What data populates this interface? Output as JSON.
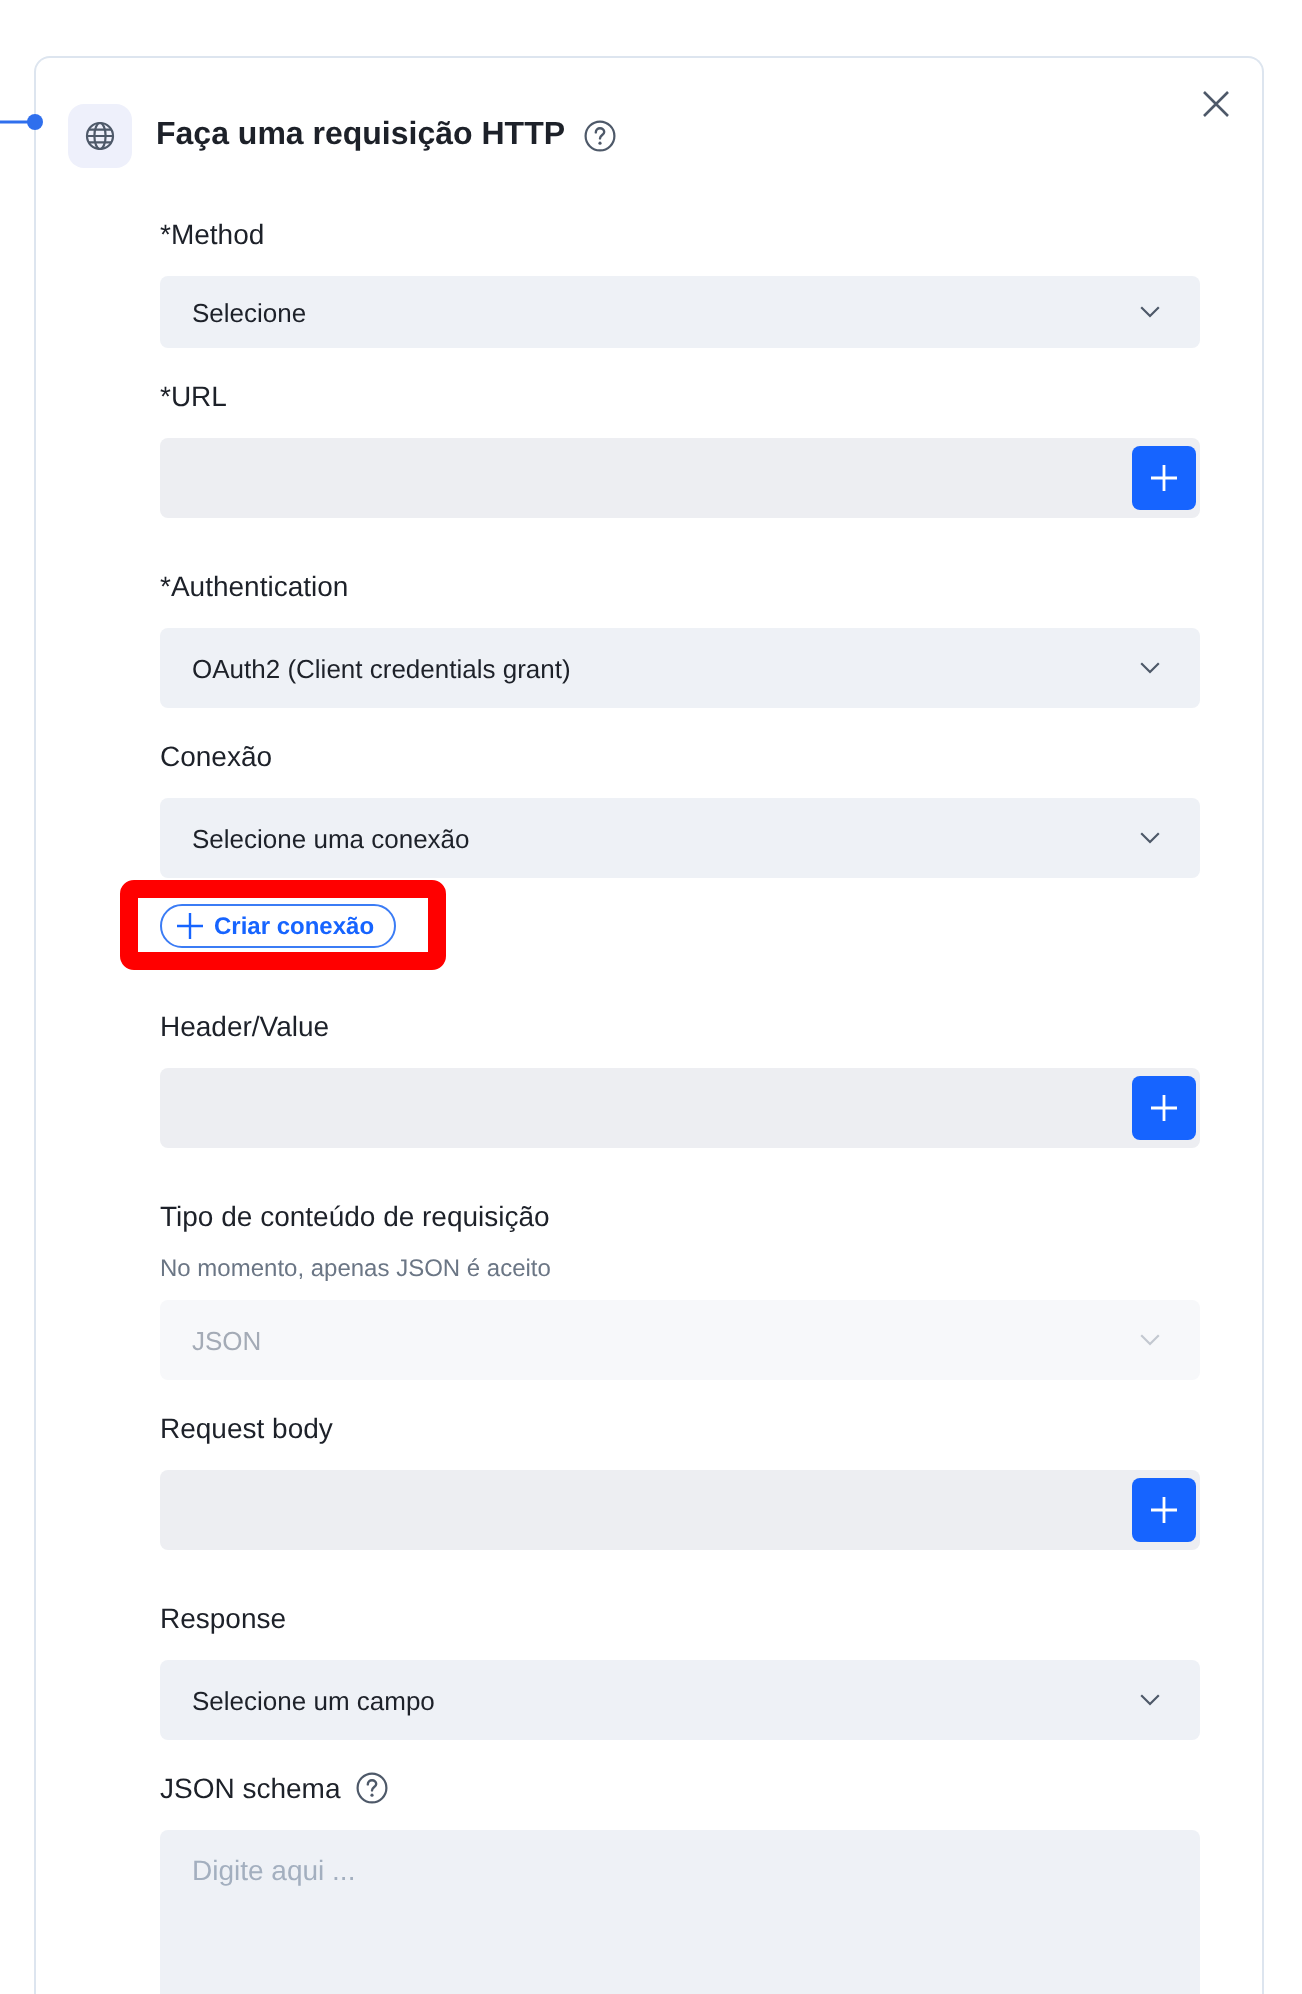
{
  "panel": {
    "title": "Faça uma requisição HTTP",
    "help": true
  },
  "fields": [
    {
      "kind": "select",
      "label": "*Method",
      "help": false,
      "value": "Selecione",
      "disabled": false
    },
    {
      "kind": "add",
      "label": "*URL",
      "help": false
    },
    {
      "kind": "select",
      "label": "*Authentication",
      "help": false,
      "value": "OAuth2 (Client credentials grant)",
      "disabled": false
    },
    {
      "kind": "select",
      "label": "Conexão",
      "help": false,
      "value": "Selecione uma conexão",
      "disabled": false,
      "action": {
        "label": "Criar conexão",
        "highlighted": true
      }
    },
    {
      "kind": "add",
      "label": "Header/Value",
      "help": false
    },
    {
      "kind": "select",
      "label": "Tipo de conteúdo de requisição",
      "help": false,
      "hint": "No momento, apenas JSON é aceito",
      "value": "JSON",
      "disabled": true
    },
    {
      "kind": "add",
      "label": "Request body",
      "help": false
    },
    {
      "kind": "select",
      "label": "Response",
      "help": false,
      "value": "Selecione um campo",
      "disabled": false
    },
    {
      "kind": "textarea",
      "label": "JSON schema",
      "help": true,
      "placeholder": "Digite aqui ..."
    }
  ]
}
